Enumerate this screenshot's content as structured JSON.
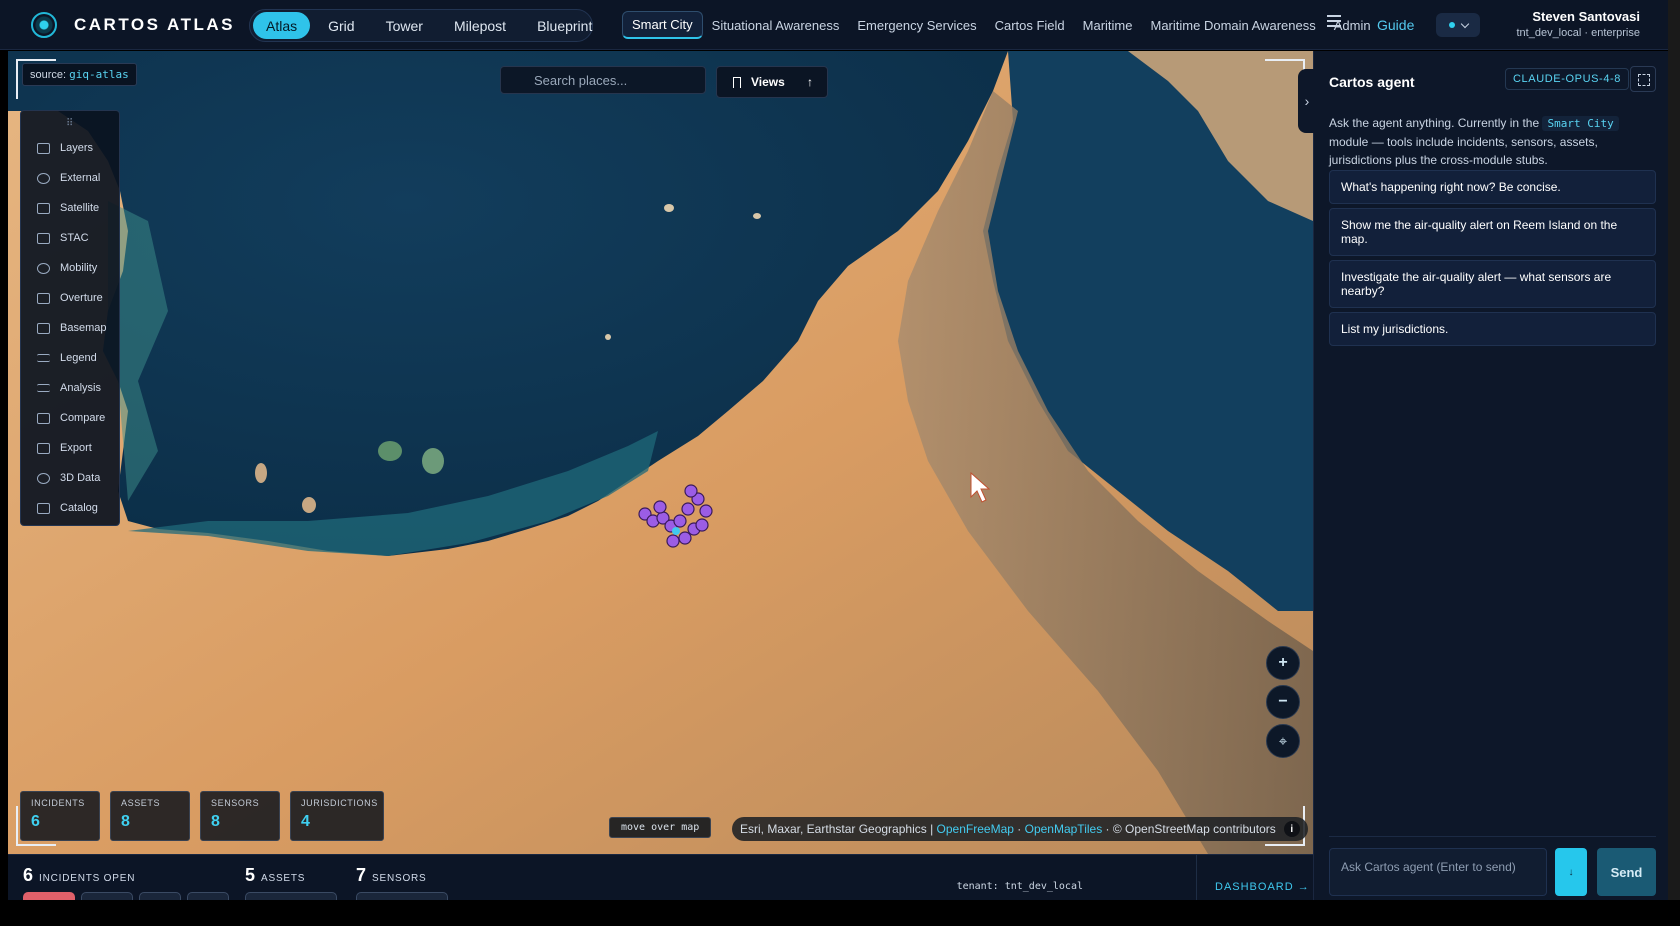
{
  "header": {
    "brand": "CARTOS ATLAS",
    "modes": [
      {
        "label": "Atlas",
        "active": true
      },
      {
        "label": "Grid",
        "active": false
      },
      {
        "label": "Tower",
        "active": false
      },
      {
        "label": "Milepost",
        "active": false
      },
      {
        "label": "Blueprint",
        "active": false
      }
    ],
    "modules": [
      {
        "label": "Smart City",
        "active": true
      },
      {
        "label": "Situational Awareness",
        "active": false
      },
      {
        "label": "Emergency Services",
        "active": false
      },
      {
        "label": "Cartos Field",
        "active": false
      },
      {
        "label": "Maritime",
        "active": false
      },
      {
        "label": "Maritime Domain Awareness",
        "active": false
      },
      {
        "label": "Admin",
        "active": false
      }
    ],
    "menu_icon": "hamburger-icon",
    "guide_label": "Guide",
    "user": {
      "name": "Steven Santovasi",
      "tenant": "tnt_dev_local · enterprise"
    }
  },
  "map": {
    "source_label": "source:",
    "source_value": "giq-atlas",
    "search_placeholder": "Search places...",
    "views_label": "Views",
    "views_arrow": "↑",
    "tools": [
      {
        "label": "Layers",
        "icon": "layers-icon"
      },
      {
        "label": "External",
        "icon": "globe-icon"
      },
      {
        "label": "Satellite",
        "icon": "satellite-icon"
      },
      {
        "label": "STAC",
        "icon": "stack-icon"
      },
      {
        "label": "Mobility",
        "icon": "mobility-icon"
      },
      {
        "label": "Overture",
        "icon": "grid-icon"
      },
      {
        "label": "Basemap",
        "icon": "map-icon"
      },
      {
        "label": "Legend",
        "icon": "list-icon"
      },
      {
        "label": "Analysis",
        "icon": "chart-icon"
      },
      {
        "label": "Compare",
        "icon": "compare-icon"
      },
      {
        "label": "Export",
        "icon": "export-icon"
      },
      {
        "label": "3D Data",
        "icon": "cube-icon"
      },
      {
        "label": "Catalog",
        "icon": "catalog-icon"
      }
    ],
    "zoom_in": "+",
    "zoom_out": "−",
    "locate_icon": "⌖",
    "stats": [
      {
        "label": "INCIDENTS",
        "value": "6"
      },
      {
        "label": "ASSETS",
        "value": "8"
      },
      {
        "label": "SENSORS",
        "value": "8"
      },
      {
        "label": "JURISDICTIONS",
        "value": "4"
      }
    ],
    "coords_label": "move over map",
    "attribution": {
      "prefix": "Esri, Maxar, Earthstar Geographics |",
      "link1": "OpenFreeMap",
      "sep": "·",
      "link2": "OpenMapTiles",
      "suffix": "· © OpenStreetMap contributors",
      "info": "i"
    }
  },
  "bottom": {
    "incidents_num": "6",
    "incidents_label": "INCIDENTS OPEN",
    "assets_num": "5",
    "assets_label": "ASSETS",
    "sensors_num": "7",
    "sensors_label": "SENSORS",
    "tenant": "tenant: tnt_dev_local",
    "dashboard": "DASHBOARD →"
  },
  "agent": {
    "title": "Cartos agent",
    "model": "CLAUDE-OPUS-4-8",
    "desc_prefix": "Ask the agent anything. Currently in the",
    "desc_module": "Smart City",
    "desc_suffix": "module — tools include incidents, sensors, assets, jurisdictions plus the cross-module stubs.",
    "suggestions": [
      "What's happening right now? Be concise.",
      "Show me the air-quality alert on Reem Island on the map.",
      "Investigate the air-quality alert — what sensors are nearby?",
      "List my jurisdictions."
    ],
    "input_placeholder": "Ask Cartos agent (Enter to send)",
    "voice_icon": "↓",
    "send_label": "Send",
    "collapse_icon": "›"
  },
  "colors": {
    "accent": "#2fc3ea",
    "topbar_bg": "#0c1526",
    "panel_bg": "#0d1729",
    "sea": "#0f3a57",
    "desert": "#d9a06a",
    "marker": "#9b5de5"
  }
}
